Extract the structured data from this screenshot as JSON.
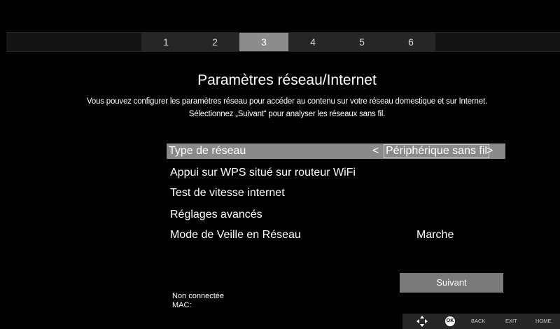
{
  "wizard": {
    "steps": [
      "1",
      "2",
      "3",
      "4",
      "5",
      "6"
    ],
    "active_step": "3"
  },
  "page": {
    "title": "Paramètres réseau/Internet",
    "description_line1": "Vous pouvez configurer les paramètres réseau pour accéder au contenu sur votre réseau domestique et sur Internet.",
    "description_line2": "Sélectionnez „Suivant“ pour analyser les réseaux sans fil."
  },
  "menu": {
    "network_type": {
      "label": "Type de réseau",
      "value": "Périphérique sans fil",
      "prev": "<",
      "next": ">"
    },
    "wps": {
      "label": "Appui sur WPS situé sur routeur WiFi"
    },
    "speed_test": {
      "label": "Test de vitesse internet"
    },
    "advanced": {
      "label": "Réglages avancés"
    },
    "standby": {
      "label": "Mode de Veille en Réseau",
      "value": "Marche"
    }
  },
  "next_button": {
    "label": "Suivant"
  },
  "status": {
    "connection": "Non connectée",
    "mac_label": "MAC:"
  },
  "nav_bar": {
    "ok": "OK",
    "back": "BACK",
    "exit": "EXIT",
    "home": "HOME"
  },
  "colors": {
    "background": "#000000",
    "selected_row": "#8a8a8a",
    "active_step": "#8c8c8c",
    "button": "#7a7a7a"
  }
}
